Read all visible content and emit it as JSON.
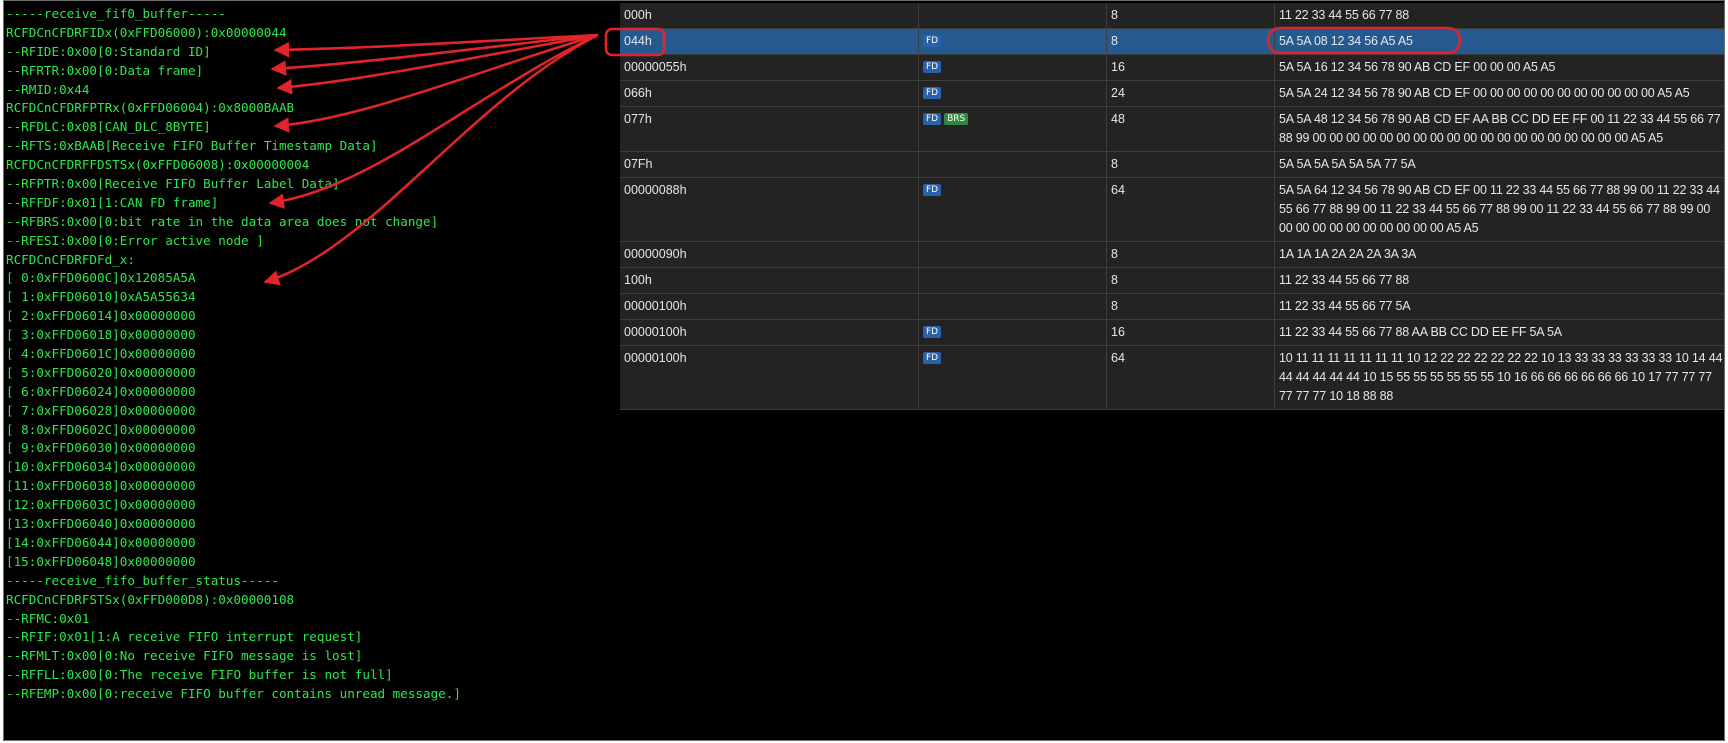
{
  "console_lines": [
    "-----receive_fif0_buffer-----",
    "RCFDCnCFDRFIDx(0xFFD06000):0x00000044",
    "--RFIDE:0x00[0:Standard ID]",
    "--RFRTR:0x00[0:Data frame]",
    "--RMID:0x44",
    "RCFDCnCFDRFPTRx(0xFFD06004):0x8000BAAB",
    "--RFDLC:0x08[CAN_DLC_8BYTE]",
    "--RFTS:0xBAAB[Receive FIFO Buffer Timestamp Data]",
    "RCFDCnCFDRFFDSTSx(0xFFD06008):0x00000004",
    "--RFPTR:0x00[Receive FIFO Buffer Label Data]",
    "--RFFDF:0x01[1:CAN FD frame]",
    "--RFBRS:0x00[0:bit rate in the data area does not change]",
    "--RFESI:0x00[0:Error active node ]",
    "RCFDCnCFDRFDFd_x:",
    "[ 0:0xFFD0600C]0x12085A5A",
    "[ 1:0xFFD06010]0xA5A55634",
    "[ 2:0xFFD06014]0x00000000",
    "[ 3:0xFFD06018]0x00000000",
    "[ 4:0xFFD0601C]0x00000000",
    "[ 5:0xFFD06020]0x00000000",
    "[ 6:0xFFD06024]0x00000000",
    "[ 7:0xFFD06028]0x00000000",
    "[ 8:0xFFD0602C]0x00000000",
    "[ 9:0xFFD06030]0x00000000",
    "[10:0xFFD06034]0x00000000",
    "[11:0xFFD06038]0x00000000",
    "[12:0xFFD0603C]0x00000000",
    "[13:0xFFD06040]0x00000000",
    "[14:0xFFD06044]0x00000000",
    "[15:0xFFD06048]0x00000000",
    "-----receive_fifo_buffer_status-----",
    "RCFDCnCFDRFSTSx(0xFFD000D8):0x00000108",
    "--RFMC:0x01",
    "--RFIF:0x01[1:A receive FIFO interrupt request]",
    "--RFMLT:0x00[0:No receive FIFO message is lost]",
    "--RFFLL:0x00[0:The receive FIFO buffer is not full]",
    "--RFEMP:0x00[0:receive FIFO buffer contains unread message.]"
  ],
  "messages": [
    {
      "id": "000h",
      "fd": false,
      "brs": false,
      "dlc": "8",
      "data": "11 22 33 44 55 66 77 88"
    },
    {
      "id": "044h",
      "fd": true,
      "brs": false,
      "dlc": "8",
      "data": "5A 5A 08 12 34 56 A5 A5",
      "selected": true
    },
    {
      "id": "00000055h",
      "fd": true,
      "brs": false,
      "dlc": "16",
      "data": "5A 5A 16 12 34 56 78 90 AB CD EF 00 00 00 A5 A5"
    },
    {
      "id": "066h",
      "fd": true,
      "brs": false,
      "dlc": "24",
      "data": "5A 5A 24 12 34 56 78 90 AB CD EF 00 00 00 00 00 00 00 00 00 00 00 A5 A5"
    },
    {
      "id": "077h",
      "fd": true,
      "brs": true,
      "dlc": "48",
      "data": "5A 5A 48 12 34 56 78 90 AB CD EF AA BB CC DD EE FF 00 11 22 33 44 55 66 77 88 99 00 00 00 00 00 00 00 00 00 00 00 00 00 00 00 00 00 00 00 A5 A5"
    },
    {
      "id": "07Fh",
      "fd": false,
      "brs": false,
      "dlc": "8",
      "data": "5A 5A 5A 5A 5A 5A 77 5A"
    },
    {
      "id": "00000088h",
      "fd": true,
      "brs": false,
      "dlc": "64",
      "data": "5A 5A 64 12 34 56 78 90 AB CD EF 00 11 22 33 44 55 66 77 88 99 00 11 22 33 44 55 66 77 88 99 00 11 22 33 44 55 66 77 88 99 00 11 22 33 44 55 66 77 88 99 00 00 00 00 00 00 00 00 00 00 00 A5 A5"
    },
    {
      "id": "00000090h",
      "fd": false,
      "brs": false,
      "dlc": "8",
      "data": "1A 1A 1A 2A 2A 2A 3A 3A"
    },
    {
      "id": "100h",
      "fd": false,
      "brs": false,
      "dlc": "8",
      "data": "11 22 33 44 55 66 77 88"
    },
    {
      "id": "00000100h",
      "fd": false,
      "brs": false,
      "dlc": "8",
      "data": "11 22 33 44 55 66 77 5A"
    },
    {
      "id": "00000100h",
      "fd": true,
      "brs": false,
      "dlc": "16",
      "data": "11 22 33 44 55 66 77 88 AA BB CC DD EE FF 5A 5A"
    },
    {
      "id": "00000100h",
      "fd": true,
      "brs": false,
      "dlc": "64",
      "data": "10 11 11 11 11 11 11 11 10 12 22 22 22 22 22 22 10 13 33 33 33 33 33 33 10 14 44 44 44 44 44 44 10 15 55 55 55 55 55 55 10 16 66 66 66 66 66 66 10 17 77 77 77 77 77 77 10 18 88 88"
    }
  ],
  "badges": {
    "fd": "FD",
    "brs": "BRS"
  },
  "annotation_color": "#e0242b"
}
